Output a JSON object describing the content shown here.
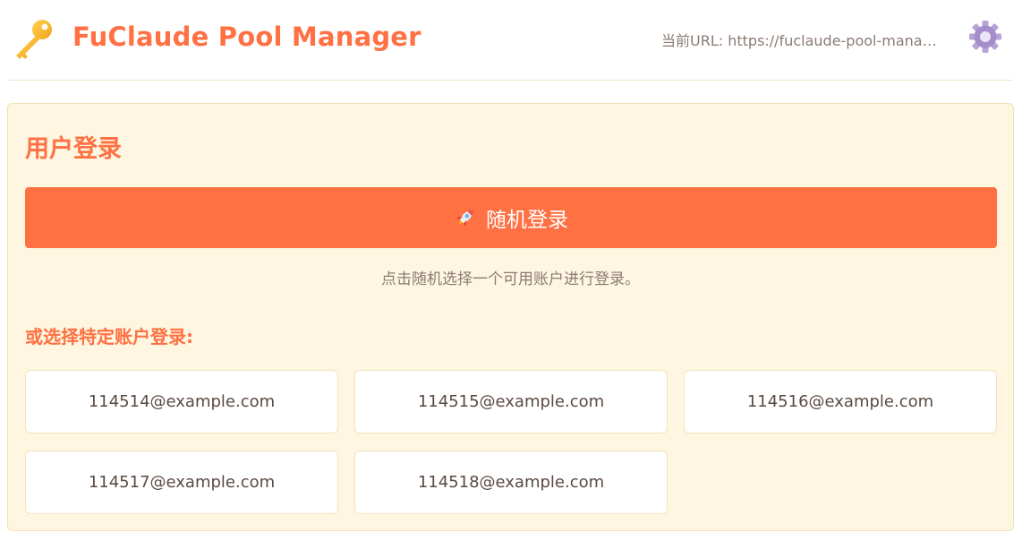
{
  "header": {
    "logo_icon": "key-icon",
    "title": "FuClaude Pool Manager",
    "url_text": "当前URL: https://fuclaude-pool-manage...",
    "settings_icon": "gear-icon"
  },
  "login_card": {
    "title": "用户登录",
    "random_button": {
      "icon": "rocket-icon",
      "label": "随机登录"
    },
    "hint": "点击随机选择一个可用账户进行登录。",
    "subtitle": "或选择特定账户登录:",
    "accounts": [
      "114514@example.com",
      "114515@example.com",
      "114516@example.com",
      "114517@example.com",
      "114518@example.com"
    ]
  },
  "colors": {
    "accent": "#ff7043",
    "card_bg": "#fef6e0",
    "card_border": "#f3e2b8",
    "text": "#5a4a42",
    "muted": "#8a7b74"
  }
}
